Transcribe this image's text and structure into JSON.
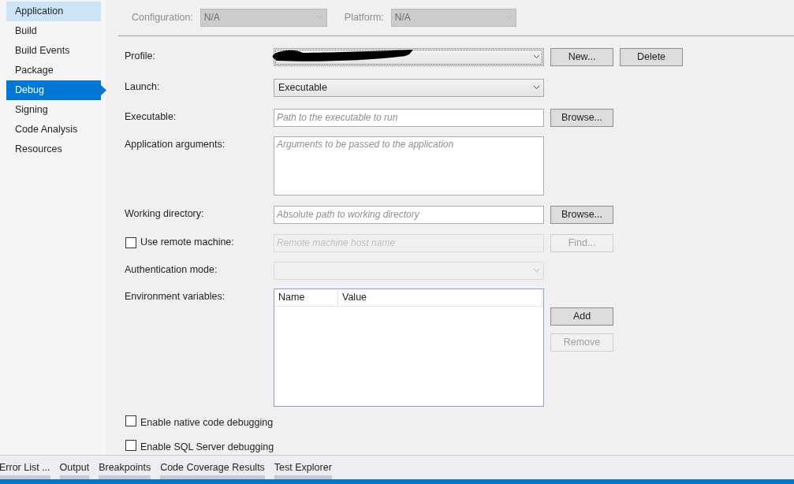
{
  "sidebar": {
    "items": [
      {
        "label": "Application",
        "selected": false,
        "hovered": true
      },
      {
        "label": "Build",
        "selected": false,
        "hovered": false
      },
      {
        "label": "Build Events",
        "selected": false,
        "hovered": false
      },
      {
        "label": "Package",
        "selected": false,
        "hovered": false
      },
      {
        "label": "Debug",
        "selected": true,
        "hovered": false
      },
      {
        "label": "Signing",
        "selected": false,
        "hovered": false
      },
      {
        "label": "Code Analysis",
        "selected": false,
        "hovered": false
      },
      {
        "label": "Resources",
        "selected": false,
        "hovered": false
      }
    ]
  },
  "configuration": {
    "label": "Configuration:",
    "value": "N/A",
    "disabled": true
  },
  "platform": {
    "label": "Platform:",
    "value": "N/A",
    "disabled": true
  },
  "form": {
    "rows": [
      {
        "kind": "combo",
        "label": "Profile:",
        "redacted": true,
        "focused": true,
        "buttons": [
          {
            "label": "New...",
            "disabled": false
          },
          {
            "label": "Delete",
            "disabled": false
          }
        ]
      },
      {
        "kind": "combo",
        "label": "Launch:",
        "value": "Executable"
      },
      {
        "kind": "input",
        "label": "Executable:",
        "placeholder": "Path to the executable to run",
        "buttons": [
          {
            "label": "Browse...",
            "disabled": false
          }
        ]
      },
      {
        "kind": "textarea",
        "label": "Application arguments:",
        "placeholder": "Arguments to be passed to the application"
      },
      {
        "kind": "input",
        "label": "Working directory:",
        "placeholder": "Absolute path to working directory",
        "buttons": [
          {
            "label": "Browse...",
            "disabled": false
          }
        ]
      },
      {
        "kind": "checkbox-input",
        "label": "Use remote machine:",
        "checked": false,
        "disabled": true,
        "placeholder": "Remote machine host name",
        "buttons": [
          {
            "label": "Find...",
            "disabled": true
          }
        ]
      },
      {
        "kind": "combo",
        "label": "Authentication mode:",
        "disabled": true
      },
      {
        "kind": "list",
        "label": "Environment variables:",
        "columns": [
          "Name",
          "Value"
        ],
        "buttons": [
          {
            "label": "Add",
            "disabled": false
          },
          {
            "label": "Remove",
            "disabled": true
          }
        ]
      },
      {
        "kind": "checkbox",
        "label": "Enable native code debugging",
        "checked": false
      },
      {
        "kind": "checkbox",
        "label": "Enable SQL Server debugging",
        "checked": false
      }
    ]
  },
  "bottom_tabs": [
    {
      "label": "Error List ..."
    },
    {
      "label": "Output"
    },
    {
      "label": "Breakpoints"
    },
    {
      "label": "Code Coverage Results"
    },
    {
      "label": "Test Explorer"
    }
  ]
}
